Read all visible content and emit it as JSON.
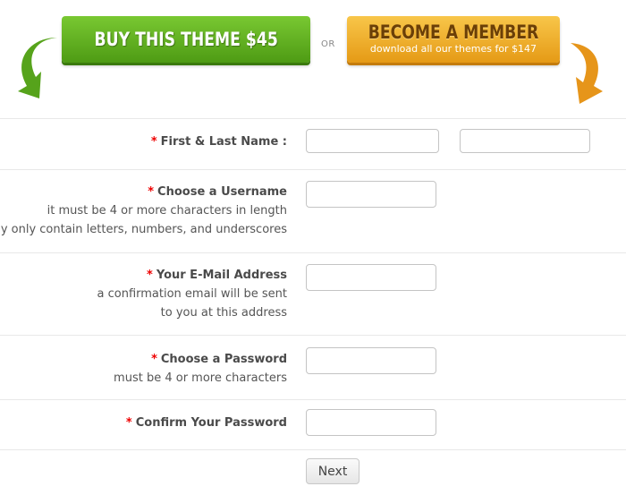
{
  "promo": {
    "buy_button": "BUY THIS THEME $45",
    "or_label": "OR",
    "member_button_title": "BECOME A MEMBER",
    "member_button_subtitle": "download all our themes for $147",
    "colors": {
      "green": "#5aa81c",
      "orange": "#f0aa28"
    }
  },
  "form": {
    "required_marker": "*",
    "fields": [
      {
        "label": "First & Last Name :",
        "hints": [],
        "first_value": "",
        "last_value": ""
      },
      {
        "label": "Choose a Username",
        "hints": [
          "it must be 4 or more characters in length",
          "may only contain letters, numbers, and underscores"
        ],
        "value": ""
      },
      {
        "label": "Your E-Mail Address",
        "hints": [
          "a confirmation email will be sent",
          "to you at this address"
        ],
        "value": ""
      },
      {
        "label": "Choose a Password",
        "hints": [
          "must be 4 or more characters"
        ],
        "value": ""
      },
      {
        "label": "Confirm Your Password",
        "hints": [],
        "value": ""
      }
    ],
    "next_button": "Next"
  }
}
